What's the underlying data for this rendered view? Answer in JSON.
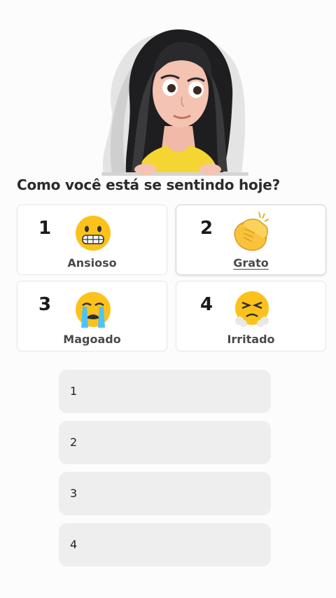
{
  "question": "Como você está se sentindo hoje?",
  "options": [
    {
      "number": "1",
      "label": "Ansioso",
      "emoji": "grimacing-face-icon",
      "selected": false
    },
    {
      "number": "2",
      "label": "Grato",
      "emoji": "clapping-hands-icon",
      "selected": true
    },
    {
      "number": "3",
      "label": "Magoado",
      "emoji": "crying-face-icon",
      "selected": false
    },
    {
      "number": "4",
      "label": "Irritado",
      "emoji": "angry-face-icon",
      "selected": false
    }
  ],
  "answers": [
    "1",
    "2",
    "3",
    "4"
  ]
}
